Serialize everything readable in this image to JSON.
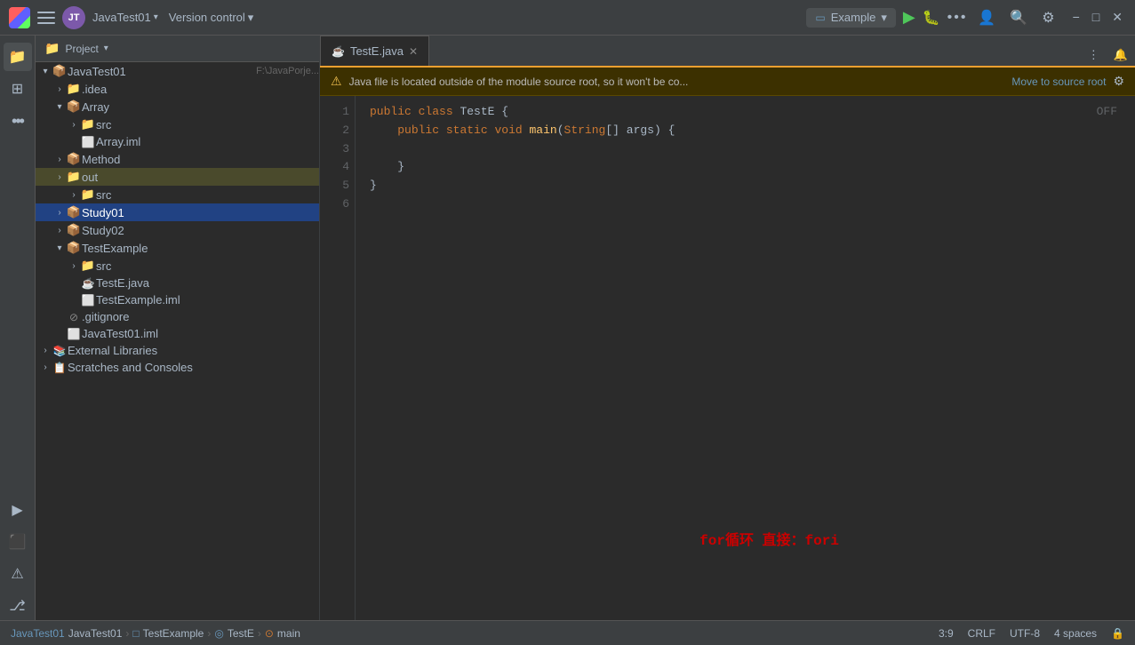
{
  "titlebar": {
    "logo_text": "JB",
    "avatar_text": "JT",
    "project_name": "JavaTest01",
    "project_caret": "▾",
    "vc_label": "Version control",
    "vc_caret": "▾",
    "run_tab_label": "Example",
    "run_tab_caret": "▾",
    "run_btn": "▶",
    "debug_btn": "🐛",
    "more_btn": "•••",
    "icon_user": "👤",
    "icon_search": "🔍",
    "icon_settings": "⚙",
    "minimize": "−",
    "maximize": "□",
    "close": "✕"
  },
  "sidebar": {
    "header_label": "Project",
    "header_caret": "▾",
    "items": [
      {
        "id": "javatest01-root",
        "label": "JavaTest01",
        "path": "F:\\JavaPorje...",
        "type": "module",
        "indent": 0,
        "expanded": true,
        "selected": false,
        "highlighted": false
      },
      {
        "id": "idea",
        "label": ".idea",
        "type": "folder",
        "indent": 1,
        "expanded": false,
        "selected": false,
        "highlighted": false
      },
      {
        "id": "array",
        "label": "Array",
        "type": "module",
        "indent": 1,
        "expanded": true,
        "selected": false,
        "highlighted": false
      },
      {
        "id": "array-src",
        "label": "src",
        "type": "folder",
        "indent": 2,
        "expanded": false,
        "selected": false,
        "highlighted": false
      },
      {
        "id": "array-iml",
        "label": "Array.iml",
        "type": "iml",
        "indent": 2,
        "expanded": false,
        "selected": false,
        "highlighted": false
      },
      {
        "id": "method",
        "label": "Method",
        "type": "module",
        "indent": 1,
        "expanded": false,
        "selected": false,
        "highlighted": false
      },
      {
        "id": "out",
        "label": "out",
        "type": "folder",
        "indent": 1,
        "expanded": false,
        "selected": false,
        "highlighted": true
      },
      {
        "id": "out-src",
        "label": "src",
        "type": "folder",
        "indent": 2,
        "expanded": false,
        "selected": false,
        "highlighted": false
      },
      {
        "id": "study01",
        "label": "Study01",
        "type": "module",
        "indent": 1,
        "expanded": false,
        "selected": true,
        "highlighted": false
      },
      {
        "id": "study02",
        "label": "Study02",
        "type": "module",
        "indent": 1,
        "expanded": false,
        "selected": false,
        "highlighted": false
      },
      {
        "id": "testexample",
        "label": "TestExample",
        "type": "module",
        "indent": 1,
        "expanded": true,
        "selected": false,
        "highlighted": false
      },
      {
        "id": "testexample-src",
        "label": "src",
        "type": "folder",
        "indent": 2,
        "expanded": false,
        "selected": false,
        "highlighted": false
      },
      {
        "id": "teste-java",
        "label": "TestE.java",
        "type": "java",
        "indent": 2,
        "expanded": false,
        "selected": false,
        "highlighted": false
      },
      {
        "id": "testexample-iml",
        "label": "TestExample.iml",
        "type": "iml",
        "indent": 2,
        "expanded": false,
        "selected": false,
        "highlighted": false
      },
      {
        "id": "gitignore",
        "label": ".gitignore",
        "type": "gitignore",
        "indent": 1,
        "expanded": false,
        "selected": false,
        "highlighted": false
      },
      {
        "id": "javatest01-iml",
        "label": "JavaTest01.iml",
        "type": "iml",
        "indent": 1,
        "expanded": false,
        "selected": false,
        "highlighted": false
      },
      {
        "id": "external-libraries",
        "label": "External Libraries",
        "type": "libraries",
        "indent": 0,
        "expanded": false,
        "selected": false,
        "highlighted": false
      },
      {
        "id": "scratches",
        "label": "Scratches and Consoles",
        "type": "scratches",
        "indent": 0,
        "expanded": false,
        "selected": false,
        "highlighted": false
      }
    ]
  },
  "editor": {
    "tab_filename": "TestE.java",
    "tab_icon": "☕",
    "off_label": "OFF",
    "warning_text": "Java file is located outside of the module source root, so it won't be co...",
    "warning_action": "Move to source root",
    "code_lines": [
      {
        "num": "1",
        "tokens": [
          {
            "t": "kw",
            "v": "public"
          },
          {
            "t": "sp",
            "v": " "
          },
          {
            "t": "kw",
            "v": "class"
          },
          {
            "t": "sp",
            "v": " "
          },
          {
            "t": "classname",
            "v": "TestE"
          },
          {
            "t": "sp",
            "v": " "
          },
          {
            "t": "brace",
            "v": "{"
          }
        ]
      },
      {
        "num": "2",
        "tokens": [
          {
            "t": "sp",
            "v": "    "
          },
          {
            "t": "kw",
            "v": "public"
          },
          {
            "t": "sp",
            "v": " "
          },
          {
            "t": "kw",
            "v": "static"
          },
          {
            "t": "sp",
            "v": " "
          },
          {
            "t": "kw",
            "v": "void"
          },
          {
            "t": "sp",
            "v": " "
          },
          {
            "t": "funcname",
            "v": "main"
          },
          {
            "t": "brace",
            "v": "("
          },
          {
            "t": "typekw",
            "v": "String"
          },
          {
            "t": "brace",
            "v": "[]"
          },
          {
            "t": "sp",
            "v": " "
          },
          {
            "t": "param",
            "v": "args"
          },
          {
            "t": "brace",
            "v": ")"
          },
          {
            "t": "sp",
            "v": " "
          },
          {
            "t": "brace",
            "v": "{"
          }
        ]
      },
      {
        "num": "3",
        "tokens": []
      },
      {
        "num": "4",
        "tokens": [
          {
            "t": "sp",
            "v": "    "
          },
          {
            "t": "brace",
            "v": "}"
          }
        ]
      },
      {
        "num": "5",
        "tokens": [
          {
            "t": "brace",
            "v": "}"
          }
        ]
      },
      {
        "num": "6",
        "tokens": []
      }
    ],
    "hint_text": "for循环  直接：fori"
  },
  "statusbar": {
    "breadcrumb_project": "JavaTest01",
    "sep1": "›",
    "breadcrumb_module": "TestExample",
    "sep2": "›",
    "breadcrumb_class": "TestE",
    "sep3": "›",
    "breadcrumb_method": "main",
    "position": "3:9",
    "line_ending": "CRLF",
    "encoding": "UTF-8",
    "indent": "4 spaces",
    "lock_icon": "🔒"
  },
  "activity_bar": {
    "icons": [
      {
        "id": "folder",
        "symbol": "📁"
      },
      {
        "id": "plugin",
        "symbol": "⊞"
      },
      {
        "id": "more",
        "symbol": "…"
      },
      {
        "id": "run",
        "symbol": "▶"
      },
      {
        "id": "terminal",
        "symbol": "⬛"
      },
      {
        "id": "problems",
        "symbol": "⚠"
      },
      {
        "id": "git",
        "symbol": "⎇"
      }
    ]
  }
}
